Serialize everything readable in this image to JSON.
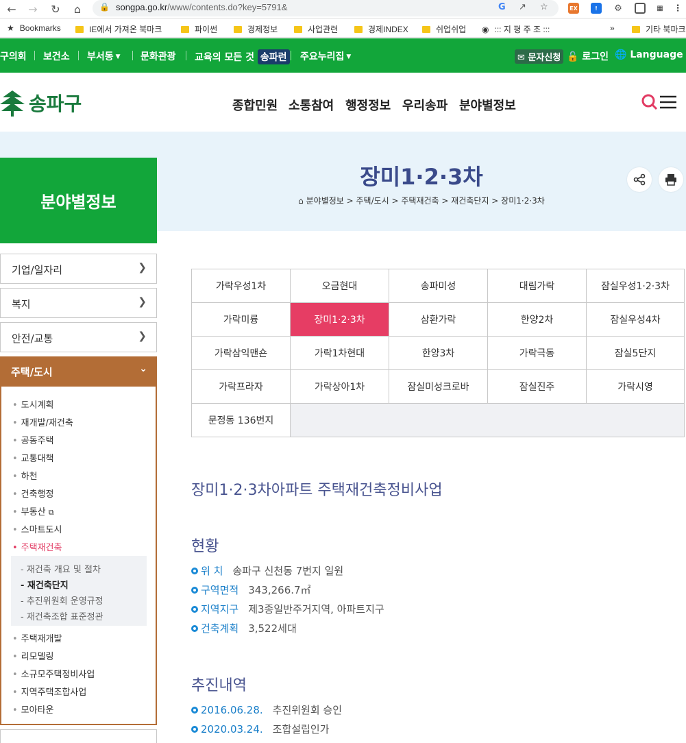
{
  "browser": {
    "url_host": "songpa.go.kr",
    "url_path": "/www/contents.do?key=5791&",
    "bookmarks": [
      {
        "label": "Bookmarks",
        "type": "star"
      },
      {
        "label": "IE에서 가져온 북마크",
        "type": "folder"
      },
      {
        "label": "파이썬",
        "type": "folder"
      },
      {
        "label": "경제정보",
        "type": "folder"
      },
      {
        "label": "사업관련",
        "type": "folder"
      },
      {
        "label": "경제INDEX",
        "type": "folder"
      },
      {
        "label": "쉬업쉬업",
        "type": "folder"
      },
      {
        "label": "::: 지 평 주 조 :::",
        "type": "globe"
      },
      {
        "label": "»",
        "type": "more"
      },
      {
        "label": "기타 북마크",
        "type": "folder"
      }
    ]
  },
  "topbar": {
    "items": [
      "구의회",
      "보건소",
      "부서동",
      "문화관광",
      "교육의 모든 것",
      "주요누리집"
    ],
    "badge": "송파런",
    "sms": "문자신청",
    "login": "로그인",
    "language": "Language"
  },
  "header": {
    "logo_text": "송파구",
    "gnb": [
      "종합민원",
      "소통참여",
      "행정정보",
      "우리송파",
      "분야별정보"
    ]
  },
  "lnb": {
    "title": "분야별정보",
    "menu": [
      "기업/일자리",
      "복지",
      "안전/교통"
    ],
    "active": "주택/도시",
    "sub": [
      "도시계획",
      "재개발/재건축",
      "공동주택",
      "교통대책",
      "하천",
      "건축행정",
      "부동산",
      "스마트도시",
      "주택재건축"
    ],
    "subsub": [
      "- 재건축 개요 및 절차",
      "- 재건축단지",
      "- 추진위원회 운영규정",
      "- 재건축조합 표준정관"
    ],
    "sub_after": [
      "주택재개발",
      "리모델링",
      "소규모주택정비사업",
      "지역주택조합사업",
      "모아타운"
    ]
  },
  "page": {
    "title": "장미1·2·3차",
    "breadcrumb": "분야별정보 > 주택/도시 > 주택재건축 > 재건축단지 > 장미1·2·3차"
  },
  "complexes": [
    "가락우성1차",
    "오금현대",
    "송파미성",
    "대림가락",
    "잠실우성1·2·3차",
    "가락미륭",
    "장미1·2·3차",
    "삼환가락",
    "한양2차",
    "잠실우성4차",
    "가락삼익맨숀",
    "가락1차현대",
    "한양3차",
    "가락극동",
    "잠실5단지",
    "가락프라자",
    "가락상아1차",
    "잠실미성크로바",
    "잠실진주",
    "가락시영",
    "문정동 136번지"
  ],
  "active_complex": "장미1·2·3차",
  "content": {
    "heading": "장미1·2·3차아파트 주택재건축정비사업",
    "status_title": "현황",
    "status": [
      {
        "key": "위 치",
        "value": "송파구 신천동 7번지 일원"
      },
      {
        "key": "구역면적",
        "value": "343,266.7㎡"
      },
      {
        "key": "지역지구",
        "value": "제3종일반주거지역, 아파트지구"
      },
      {
        "key": "건축계획",
        "value": "3,522세대"
      }
    ],
    "history_title": "추진내역",
    "history": [
      {
        "date": "2016.06.28.",
        "event": "추진위원회 승인"
      },
      {
        "date": "2020.03.24.",
        "event": "조합설립인가"
      }
    ]
  }
}
